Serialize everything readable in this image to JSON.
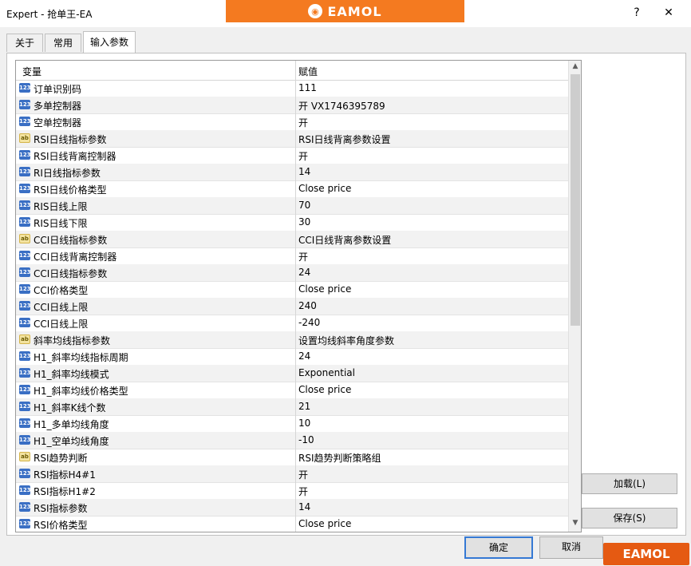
{
  "window": {
    "title": "Expert - 抢单王-EA",
    "help": "?",
    "close": "✕"
  },
  "banner": {
    "logo_text": "EAMOL"
  },
  "tabs": [
    {
      "label": "关于"
    },
    {
      "label": "常用"
    },
    {
      "label": "输入参数"
    }
  ],
  "grid": {
    "col_var": "变量",
    "col_val": "赋值",
    "rows": [
      {
        "name": "订单识别码",
        "value": "111",
        "icon": "num"
      },
      {
        "name": "多单控制器",
        "value": "开   VX1746395789",
        "icon": "num"
      },
      {
        "name": "空单控制器",
        "value": "开",
        "icon": "num"
      },
      {
        "name": "RSI日线指标参数",
        "value": "RSI日线背离参数设置",
        "icon": "str"
      },
      {
        "name": "RSI日线背离控制器",
        "value": "开",
        "icon": "num"
      },
      {
        "name": "RI日线指标参数",
        "value": "14",
        "icon": "num"
      },
      {
        "name": "RSI日线价格类型",
        "value": "Close price",
        "icon": "num"
      },
      {
        "name": "RIS日线上限",
        "value": "70",
        "icon": "num"
      },
      {
        "name": "RIS日线下限",
        "value": "30",
        "icon": "num"
      },
      {
        "name": "CCI日线指标参数",
        "value": "CCI日线背离参数设置",
        "icon": "str"
      },
      {
        "name": "CCI日线背离控制器",
        "value": "开",
        "icon": "num"
      },
      {
        "name": "CCI日线指标参数",
        "value": "24",
        "icon": "num"
      },
      {
        "name": "CCI价格类型",
        "value": "Close price",
        "icon": "num"
      },
      {
        "name": "CCI日线上限",
        "value": "240",
        "icon": "num"
      },
      {
        "name": "CCI日线上限",
        "value": "-240",
        "icon": "num"
      },
      {
        "name": "斜率均线指标参数",
        "value": "设置均线斜率角度参数",
        "icon": "str"
      },
      {
        "name": "H1_斜率均线指标周期",
        "value": "24",
        "icon": "num"
      },
      {
        "name": "H1_斜率均线模式",
        "value": "Exponential",
        "icon": "num"
      },
      {
        "name": "H1_斜率均线价格类型",
        "value": "Close price",
        "icon": "num"
      },
      {
        "name": "H1_斜率K线个数",
        "value": "21",
        "icon": "num"
      },
      {
        "name": "H1_多单均线角度",
        "value": "10",
        "icon": "num"
      },
      {
        "name": "H1_空单均线角度",
        "value": "-10",
        "icon": "num"
      },
      {
        "name": "RSI趋势判断",
        "value": "RSI趋势判断策略组",
        "icon": "str"
      },
      {
        "name": "RSI指标H4#1",
        "value": "开",
        "icon": "num"
      },
      {
        "name": "RSI指标H1#2",
        "value": "开",
        "icon": "num"
      },
      {
        "name": "RSI指标参数",
        "value": "14",
        "icon": "num"
      },
      {
        "name": "RSI价格类型",
        "value": "Close price",
        "icon": "num"
      }
    ],
    "num_icon_text": "123",
    "str_icon_text": "ab"
  },
  "buttons": {
    "load": "加载(L)",
    "save": "保存(S)",
    "ok": "确定",
    "cancel": "取消"
  },
  "watermark": {
    "logo_text": "EAMOL"
  }
}
